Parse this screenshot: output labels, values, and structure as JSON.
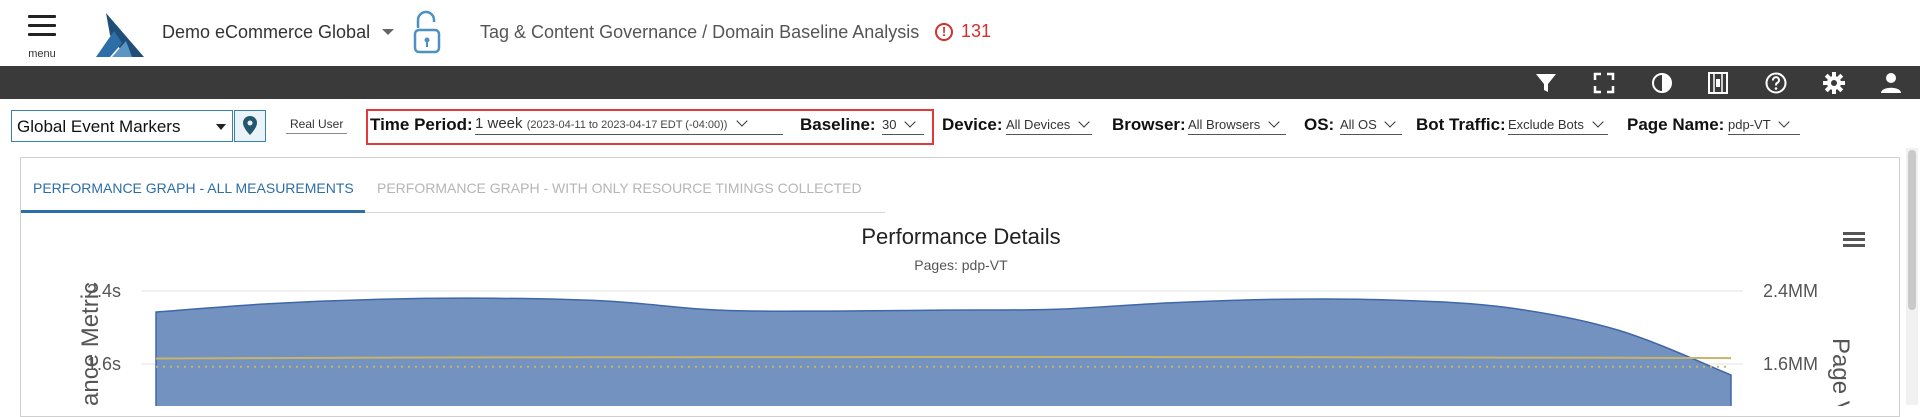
{
  "header": {
    "menu_label": "menu",
    "company": "Demo eCommerce Global",
    "breadcrumb": "Tag & Content Governance / Domain Baseline Analysis",
    "alert_count": "131"
  },
  "toolbar": {
    "icons": [
      "filter-icon",
      "fullscreen-icon",
      "contrast-icon",
      "film-icon",
      "help-icon",
      "settings-icon",
      "user-icon"
    ]
  },
  "filters": {
    "event_markers": "Global Event Markers",
    "real_user": "Real User",
    "time_period_label": "Time Period:",
    "time_period_value": "1 week",
    "time_period_range": "(2023-04-11 to 2023-04-17 EDT (-04:00))",
    "baseline_label": "Baseline:",
    "baseline_value": "30",
    "device_label": "Device:",
    "device_value": "All Devices",
    "browser_label": "Browser:",
    "browser_value": "All Browsers",
    "os_label": "OS:",
    "os_value": "All OS",
    "bot_label": "Bot Traffic:",
    "bot_value": "Exclude Bots",
    "page_label": "Page Name:",
    "page_value": "pdp-VT"
  },
  "tabs": [
    {
      "label": "PERFORMANCE GRAPH - ALL MEASUREMENTS",
      "active": true
    },
    {
      "label": "PERFORMANCE GRAPH - WITH ONLY RESOURCE TIMINGS COLLECTED",
      "active": false
    }
  ],
  "colors": {
    "accent": "#2e6ea8",
    "area_fill": "#7392c0",
    "area_stroke": "#3e66a8",
    "baseline_line": "#c8b36a",
    "alert": "#d32f2f",
    "toolbar": "#3a3a3a"
  },
  "chart_data": {
    "type": "area",
    "title": "Performance Details",
    "subtitle": "Pages: pdp-VT",
    "ylabel_left": "ance Metric",
    "ylabel_right": "Page V",
    "left_ticks": [
      "2.4s",
      "1.6s"
    ],
    "right_ticks": [
      "2.4MM",
      "1.6MM"
    ],
    "y_left_values": [
      2.4,
      1.6
    ],
    "series": [
      {
        "values": [
          2.17,
          2.26,
          2.31,
          2.32,
          2.29,
          2.19,
          2.18,
          2.19,
          2.2,
          2.27,
          2.31,
          2.3,
          2.22,
          1.97,
          1.48
        ]
      },
      {
        "values": [
          1.66,
          1.665,
          1.67,
          1.672,
          1.674,
          1.675,
          1.676,
          1.677,
          1.677,
          1.676,
          1.675,
          1.673,
          1.67,
          1.668,
          1.665
        ]
      },
      {
        "values": [
          1.57,
          1.57,
          1.57,
          1.57,
          1.57,
          1.57,
          1.57,
          1.57,
          1.57,
          1.57,
          1.57,
          1.57,
          1.57,
          1.57,
          1.57
        ]
      }
    ],
    "ylim": [
      0,
      2.4
    ]
  }
}
